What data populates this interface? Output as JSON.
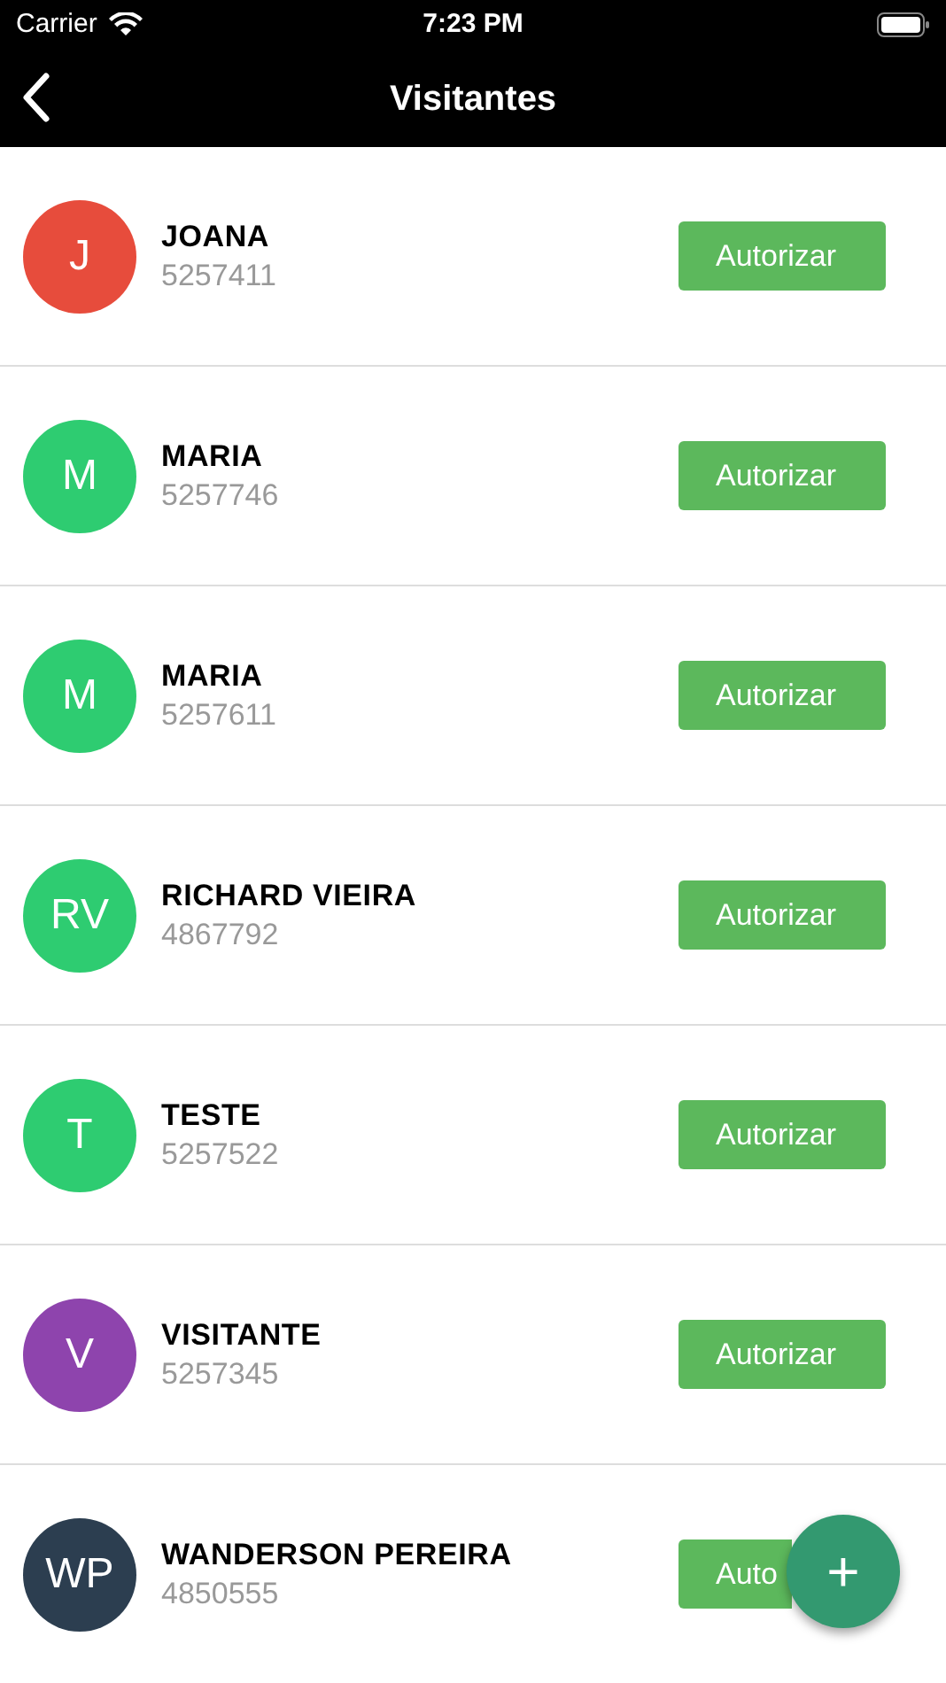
{
  "status_bar": {
    "carrier": "Carrier",
    "time": "7:23 PM"
  },
  "nav_bar": {
    "title": "Visitantes"
  },
  "visitors": [
    {
      "initials": "J",
      "name": "JOANA",
      "number": "5257411",
      "color": "#e74c3c",
      "action": "Autorizar"
    },
    {
      "initials": "M",
      "name": "MARIA",
      "number": "5257746",
      "color": "#2ecc71",
      "action": "Autorizar"
    },
    {
      "initials": "M",
      "name": "MARIA",
      "number": "5257611",
      "color": "#2ecc71",
      "action": "Autorizar"
    },
    {
      "initials": "RV",
      "name": "RICHARD VIEIRA",
      "number": "4867792",
      "color": "#2ecc71",
      "action": "Autorizar"
    },
    {
      "initials": "T",
      "name": "TESTE",
      "number": "5257522",
      "color": "#2ecc71",
      "action": "Autorizar"
    },
    {
      "initials": "V",
      "name": "VISITANTE",
      "number": "5257345",
      "color": "#8e44ad",
      "action": "Autorizar"
    },
    {
      "initials": "WP",
      "name": "WANDERSON PEREIRA",
      "number": "4850555",
      "color": "#2c3e50",
      "action": "Auto",
      "kind": "clipped"
    }
  ],
  "fab": {
    "label": "+"
  }
}
